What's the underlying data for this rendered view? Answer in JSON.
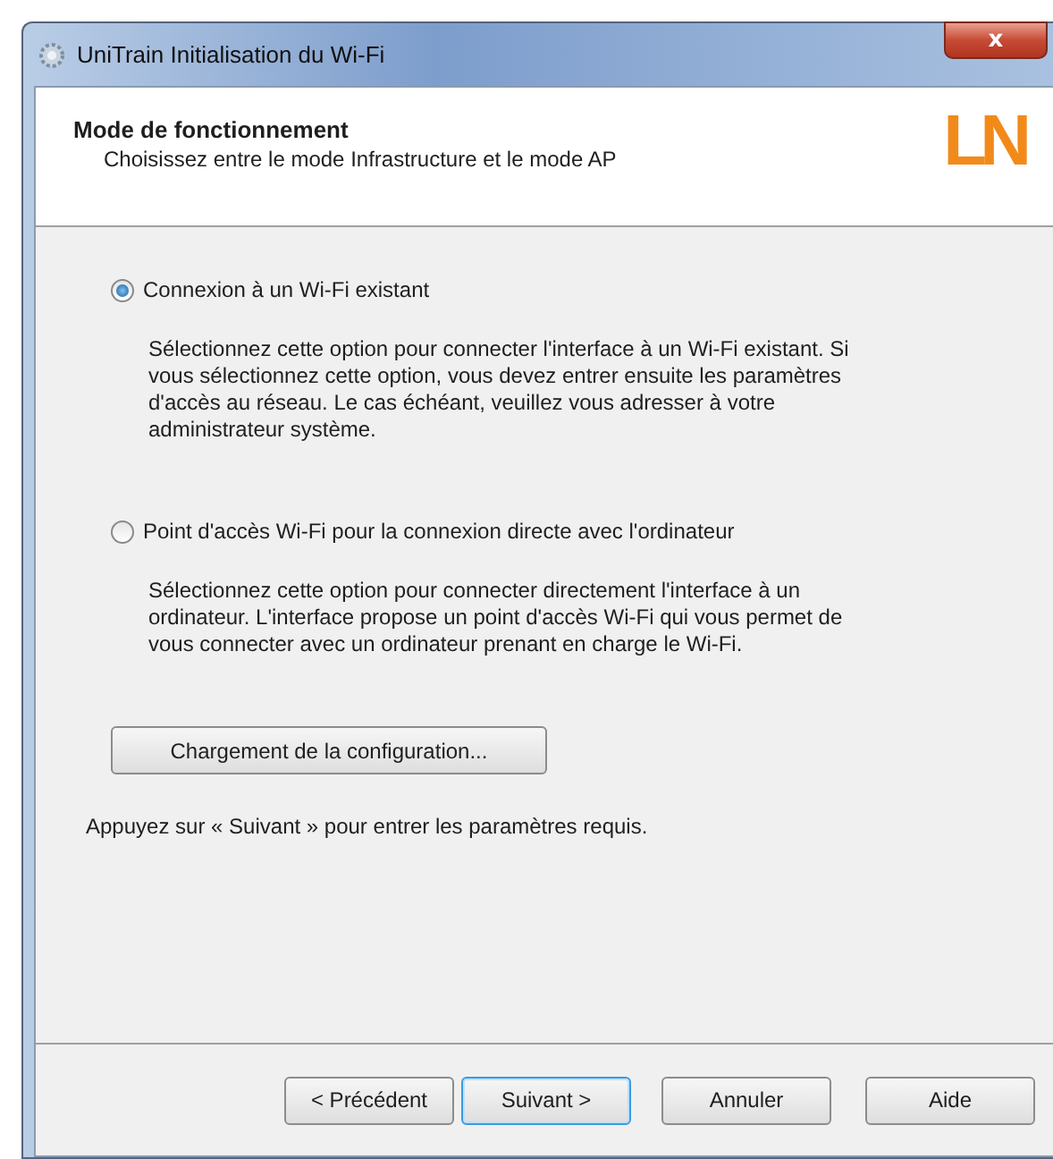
{
  "window": {
    "title": "UniTrain Initialisation du Wi-Fi",
    "close": "x"
  },
  "header": {
    "title": "Mode de fonctionnement",
    "subtitle": "Choisissez entre le mode Infrastructure et le mode AP",
    "logo": "LN"
  },
  "options": [
    {
      "label": "Connexion à un Wi-Fi existant",
      "selected": true,
      "description": "Sélectionnez cette option pour connecter l'interface à un Wi-Fi existant. Si vous sélectionnez cette option, vous devez entrer ensuite les paramètres d'accès au réseau. Le cas échéant, veuillez vous adresser à votre administrateur système."
    },
    {
      "label": "Point d'accès Wi-Fi pour la connexion directe avec l'ordinateur",
      "selected": false,
      "description": "Sélectionnez cette option pour connecter directement l'interface à un ordinateur. L'interface propose un point d'accès Wi-Fi qui vous permet de vous connecter avec un ordinateur prenant en charge le Wi-Fi."
    }
  ],
  "config_button": "Chargement de la configuration...",
  "hint": "Appuyez sur « Suivant » pour entrer les paramètres requis.",
  "buttons": [
    {
      "label": "< Précédent",
      "focused": false
    },
    {
      "label": "Suivant >",
      "focused": true
    },
    {
      "label": "Annuler",
      "focused": false
    },
    {
      "label": "Aide",
      "focused": false
    }
  ]
}
